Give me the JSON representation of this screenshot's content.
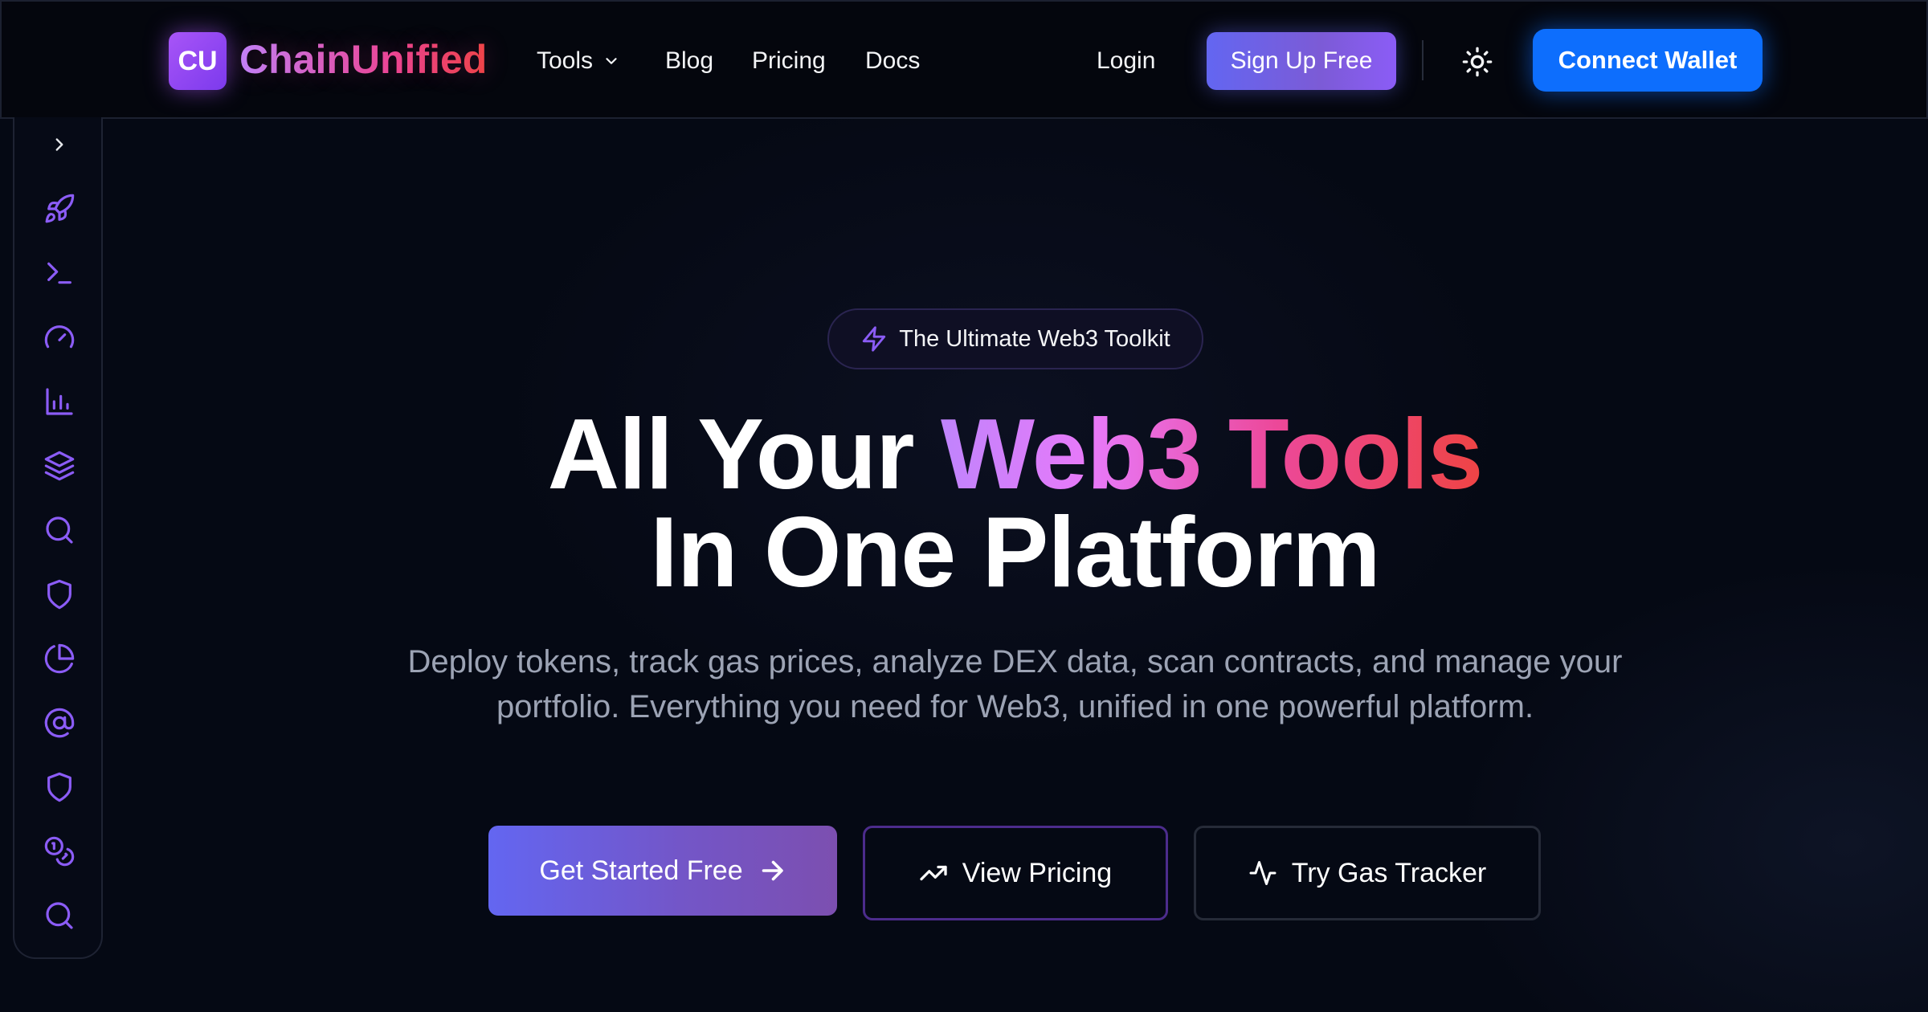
{
  "header": {
    "logo_initials": "CU",
    "logo_name": "ChainUnified",
    "nav": {
      "tools": "Tools",
      "blog": "Blog",
      "pricing": "Pricing",
      "docs": "Docs"
    },
    "login": "Login",
    "signup": "Sign Up Free",
    "connect_wallet": "Connect Wallet"
  },
  "sidebar": {
    "items": [
      {
        "icon": "chevron-right-icon"
      },
      {
        "icon": "rocket-icon"
      },
      {
        "icon": "terminal-icon"
      },
      {
        "icon": "gauge-icon"
      },
      {
        "icon": "bar-chart-icon"
      },
      {
        "icon": "layers-icon"
      },
      {
        "icon": "search-icon"
      },
      {
        "icon": "shield-icon"
      },
      {
        "icon": "pie-chart-icon"
      },
      {
        "icon": "at-sign-icon"
      },
      {
        "icon": "shield-icon"
      },
      {
        "icon": "coins-icon"
      },
      {
        "icon": "search-icon"
      }
    ],
    "icon_color": "#8b5cf6"
  },
  "hero": {
    "badge": "The Ultimate Web3 Toolkit",
    "title_part1": "All Your ",
    "title_highlight": "Web3 Tools",
    "title_line2": "In One Platform",
    "subtitle": "Deploy tokens, track gas prices, analyze DEX data, scan contracts, and manage your portfolio. Everything you need for Web3, unified in one powerful platform.",
    "cta_primary": "Get Started Free",
    "cta_pricing": "View Pricing",
    "cta_gas": "Try Gas Tracker"
  },
  "colors": {
    "background": "#050914",
    "accent_purple": "#8b5cf6",
    "accent_blue": "#0d6efd",
    "gradient_pink": "#ec4899",
    "gradient_red": "#ef4444"
  }
}
